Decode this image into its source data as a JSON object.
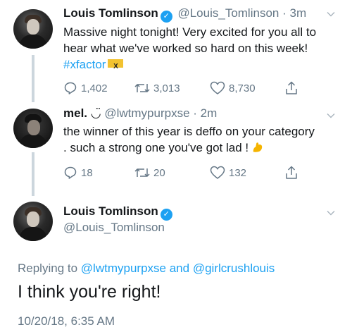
{
  "tweet1": {
    "name": "Louis Tomlinson",
    "handle": "@Louis_Tomlinson",
    "separator": "·",
    "time": "3m",
    "text_line1": "Massive night tonight! Very excited for you all to",
    "text_line2": "hear what we've worked so hard on this week!",
    "hashtag": "#xfactor",
    "replies": "1,402",
    "retweets": "3,013",
    "likes": "8,730"
  },
  "tweet2": {
    "name": "mel.",
    "name_emoji": "◡̈",
    "handle": "@lwtmypurpxse",
    "separator": "·",
    "time": "2m",
    "text_line1": "the winner of this year is deffo on your category",
    "text_line2": ". such a strong one you've got lad !",
    "replies": "18",
    "retweets": "20",
    "likes": "132"
  },
  "main_tweet": {
    "name": "Louis Tomlinson",
    "handle": "@Louis_Tomlinson",
    "replying_prefix": "Replying to",
    "reply_user1": "@lwtmypurpxse",
    "reply_and": "and",
    "reply_user2": "@girlcrushlouis",
    "text": "I think you're right!",
    "timestamp": "10/20/18, 6:35 AM"
  },
  "colors": {
    "accent": "#1da1f2",
    "secondary_text": "#657786",
    "thread_line": "#ccd6dd"
  }
}
